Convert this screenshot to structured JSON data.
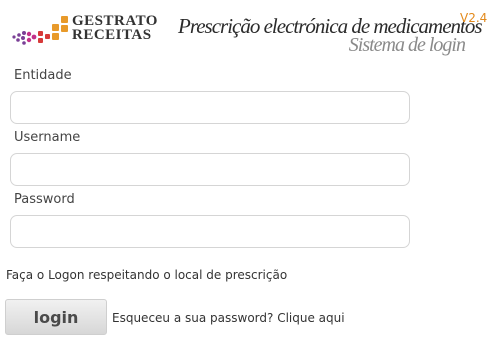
{
  "header": {
    "logo": {
      "name_line1": "GESTRATO",
      "name_line2": "RECEITAS"
    },
    "title": "Prescrição electrónica de medicamentos",
    "subtitle": "Sistema de login",
    "version": "V2.4"
  },
  "form": {
    "fields": [
      {
        "label": "Entidade",
        "value": ""
      },
      {
        "label": "Username",
        "value": ""
      },
      {
        "label": "Password",
        "value": ""
      }
    ],
    "hint": "Faça o Logon respeitando o local de prescrição",
    "login_label": "login",
    "forgot_link": "Esqueceu a sua password? Clique aqui"
  },
  "colors": {
    "version_accent": "#e38a1c",
    "logo_purple": "#7a3f96",
    "logo_red": "#d73a3a",
    "logo_orange": "#e89a2a"
  }
}
